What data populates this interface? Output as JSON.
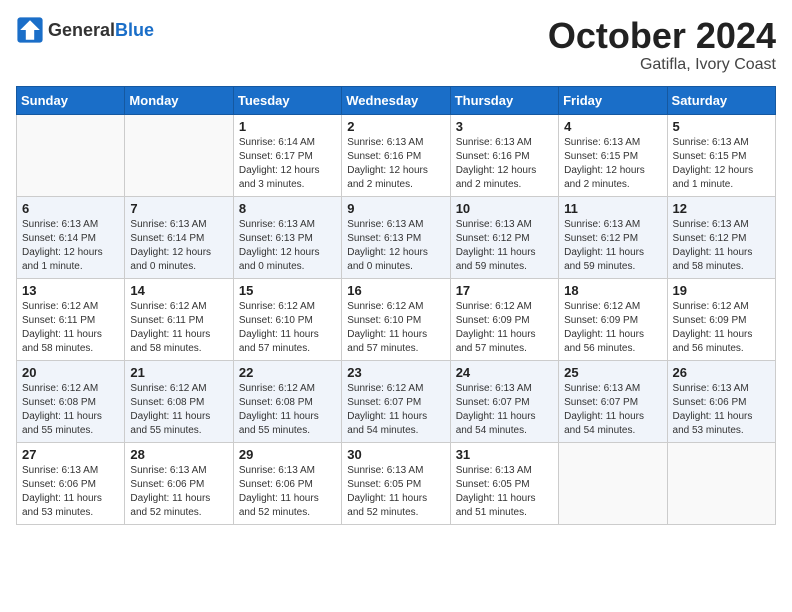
{
  "logo": {
    "general": "General",
    "blue": "Blue"
  },
  "header": {
    "month": "October 2024",
    "location": "Gatifla, Ivory Coast"
  },
  "weekdays": [
    "Sunday",
    "Monday",
    "Tuesday",
    "Wednesday",
    "Thursday",
    "Friday",
    "Saturday"
  ],
  "weeks": [
    [
      {
        "day": "",
        "info": ""
      },
      {
        "day": "",
        "info": ""
      },
      {
        "day": "1",
        "info": "Sunrise: 6:14 AM\nSunset: 6:17 PM\nDaylight: 12 hours and 3 minutes."
      },
      {
        "day": "2",
        "info": "Sunrise: 6:13 AM\nSunset: 6:16 PM\nDaylight: 12 hours and 2 minutes."
      },
      {
        "day": "3",
        "info": "Sunrise: 6:13 AM\nSunset: 6:16 PM\nDaylight: 12 hours and 2 minutes."
      },
      {
        "day": "4",
        "info": "Sunrise: 6:13 AM\nSunset: 6:15 PM\nDaylight: 12 hours and 2 minutes."
      },
      {
        "day": "5",
        "info": "Sunrise: 6:13 AM\nSunset: 6:15 PM\nDaylight: 12 hours and 1 minute."
      }
    ],
    [
      {
        "day": "6",
        "info": "Sunrise: 6:13 AM\nSunset: 6:14 PM\nDaylight: 12 hours and 1 minute."
      },
      {
        "day": "7",
        "info": "Sunrise: 6:13 AM\nSunset: 6:14 PM\nDaylight: 12 hours and 0 minutes."
      },
      {
        "day": "8",
        "info": "Sunrise: 6:13 AM\nSunset: 6:13 PM\nDaylight: 12 hours and 0 minutes."
      },
      {
        "day": "9",
        "info": "Sunrise: 6:13 AM\nSunset: 6:13 PM\nDaylight: 12 hours and 0 minutes."
      },
      {
        "day": "10",
        "info": "Sunrise: 6:13 AM\nSunset: 6:12 PM\nDaylight: 11 hours and 59 minutes."
      },
      {
        "day": "11",
        "info": "Sunrise: 6:13 AM\nSunset: 6:12 PM\nDaylight: 11 hours and 59 minutes."
      },
      {
        "day": "12",
        "info": "Sunrise: 6:13 AM\nSunset: 6:12 PM\nDaylight: 11 hours and 58 minutes."
      }
    ],
    [
      {
        "day": "13",
        "info": "Sunrise: 6:12 AM\nSunset: 6:11 PM\nDaylight: 11 hours and 58 minutes."
      },
      {
        "day": "14",
        "info": "Sunrise: 6:12 AM\nSunset: 6:11 PM\nDaylight: 11 hours and 58 minutes."
      },
      {
        "day": "15",
        "info": "Sunrise: 6:12 AM\nSunset: 6:10 PM\nDaylight: 11 hours and 57 minutes."
      },
      {
        "day": "16",
        "info": "Sunrise: 6:12 AM\nSunset: 6:10 PM\nDaylight: 11 hours and 57 minutes."
      },
      {
        "day": "17",
        "info": "Sunrise: 6:12 AM\nSunset: 6:09 PM\nDaylight: 11 hours and 57 minutes."
      },
      {
        "day": "18",
        "info": "Sunrise: 6:12 AM\nSunset: 6:09 PM\nDaylight: 11 hours and 56 minutes."
      },
      {
        "day": "19",
        "info": "Sunrise: 6:12 AM\nSunset: 6:09 PM\nDaylight: 11 hours and 56 minutes."
      }
    ],
    [
      {
        "day": "20",
        "info": "Sunrise: 6:12 AM\nSunset: 6:08 PM\nDaylight: 11 hours and 55 minutes."
      },
      {
        "day": "21",
        "info": "Sunrise: 6:12 AM\nSunset: 6:08 PM\nDaylight: 11 hours and 55 minutes."
      },
      {
        "day": "22",
        "info": "Sunrise: 6:12 AM\nSunset: 6:08 PM\nDaylight: 11 hours and 55 minutes."
      },
      {
        "day": "23",
        "info": "Sunrise: 6:12 AM\nSunset: 6:07 PM\nDaylight: 11 hours and 54 minutes."
      },
      {
        "day": "24",
        "info": "Sunrise: 6:13 AM\nSunset: 6:07 PM\nDaylight: 11 hours and 54 minutes."
      },
      {
        "day": "25",
        "info": "Sunrise: 6:13 AM\nSunset: 6:07 PM\nDaylight: 11 hours and 54 minutes."
      },
      {
        "day": "26",
        "info": "Sunrise: 6:13 AM\nSunset: 6:06 PM\nDaylight: 11 hours and 53 minutes."
      }
    ],
    [
      {
        "day": "27",
        "info": "Sunrise: 6:13 AM\nSunset: 6:06 PM\nDaylight: 11 hours and 53 minutes."
      },
      {
        "day": "28",
        "info": "Sunrise: 6:13 AM\nSunset: 6:06 PM\nDaylight: 11 hours and 52 minutes."
      },
      {
        "day": "29",
        "info": "Sunrise: 6:13 AM\nSunset: 6:06 PM\nDaylight: 11 hours and 52 minutes."
      },
      {
        "day": "30",
        "info": "Sunrise: 6:13 AM\nSunset: 6:05 PM\nDaylight: 11 hours and 52 minutes."
      },
      {
        "day": "31",
        "info": "Sunrise: 6:13 AM\nSunset: 6:05 PM\nDaylight: 11 hours and 51 minutes."
      },
      {
        "day": "",
        "info": ""
      },
      {
        "day": "",
        "info": ""
      }
    ]
  ]
}
